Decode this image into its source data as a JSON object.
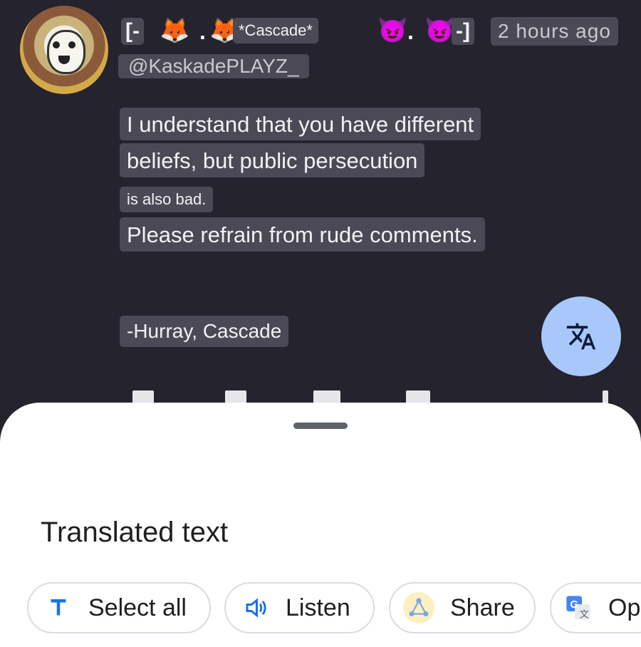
{
  "post": {
    "name_open": "[-",
    "name_dot1": ".",
    "display_name": "*Cascade*",
    "name_dot2": ".",
    "name_close": "-]",
    "timestamp": "2 hours ago",
    "handle": "@KaskadePLAYZ_",
    "lines": [
      "I understand that you have different",
      "beliefs, but public persecution",
      "is also bad.",
      "Please refrain from rude comments.",
      "-Hurray, Cascade"
    ]
  },
  "icons": {
    "fox": "🦊",
    "devil": "😈",
    "translate": "translate-icon"
  },
  "sheet": {
    "title": "Translated text",
    "actions": [
      {
        "label": "Select all",
        "icon": "text-select-icon"
      },
      {
        "label": "Listen",
        "icon": "speaker-icon"
      },
      {
        "label": "Share",
        "icon": "share-icon"
      },
      {
        "label": "Op",
        "icon": "google-translate-icon"
      }
    ]
  },
  "colors": {
    "background": "#24232e",
    "highlight": "#4a4955",
    "fab": "#a8c7fa",
    "accent_blue": "#1a73e8"
  }
}
